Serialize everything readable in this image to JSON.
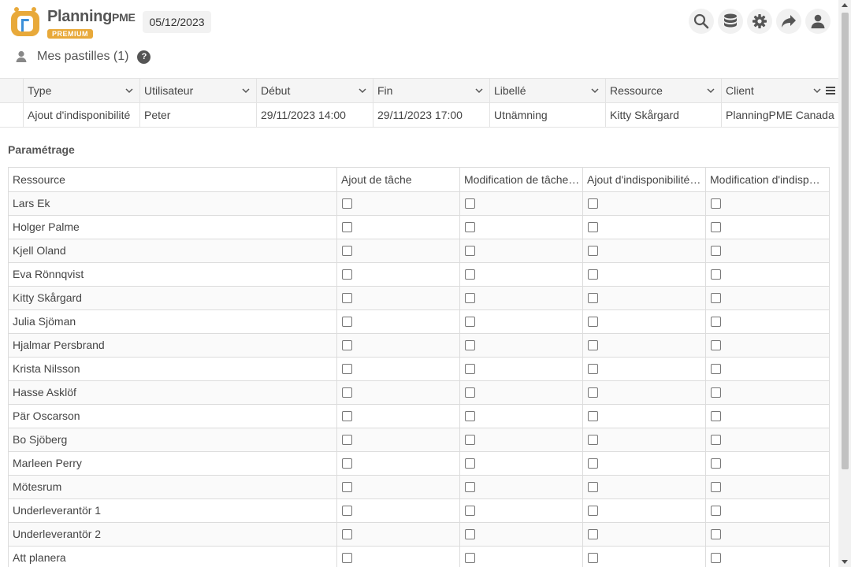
{
  "app": {
    "brand_name": "Planning",
    "brand_suffix": "PME",
    "brand_badge": "PREMIUM",
    "date": "05/12/2023",
    "toolbar": [
      "search-icon",
      "database-icon",
      "gear-icon",
      "share-icon",
      "user-icon"
    ]
  },
  "page": {
    "title": "Mes pastilles (1)",
    "help": "?"
  },
  "top_grid": {
    "columns": [
      "Type",
      "Utilisateur",
      "Début",
      "Fin",
      "Libellé",
      "Ressource",
      "Client"
    ],
    "rows": [
      [
        "Ajout d'indisponibilité",
        "Peter",
        "29/11/2023 14:00",
        "29/11/2023 17:00",
        "Utnämning",
        "Kitty Skårgard",
        "PlanningPME Canada"
      ]
    ]
  },
  "settings": {
    "label": "Paramétrage",
    "columns": [
      "Ressource",
      "Ajout de tâche",
      "Modification de tâche…",
      "Ajout d'indisponibilité…",
      "Modification d'indisp…"
    ],
    "rows": [
      "Lars Ek",
      "Holger Palme",
      "Kjell Oland",
      "Eva Rönnqvist",
      "Kitty Skårgard",
      "Julia Sjöman",
      "Hjalmar Persbrand",
      "Krista Nilsson",
      "Hasse Asklöf",
      "Pär Oscarson",
      "Bo Sjöberg",
      "Marleen Perry",
      "Mötesrum",
      "Underleverantör 1",
      "Underleverantör 2",
      "Att planera"
    ]
  },
  "colors": {
    "accent": "#e8a93a",
    "logo_blue": "#3b8fd9"
  }
}
